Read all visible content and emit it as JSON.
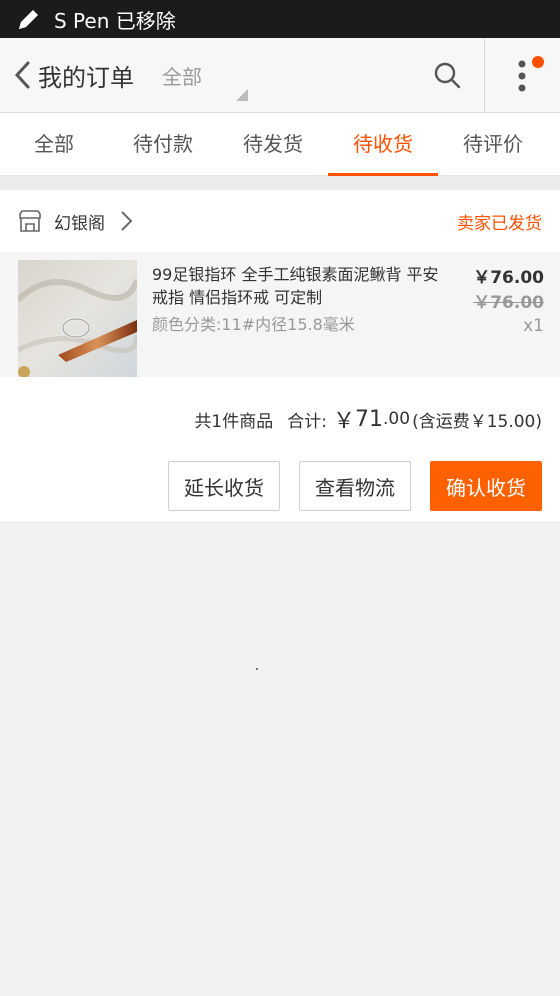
{
  "status_bar": {
    "text": "S Pen 已移除",
    "icon": "pen-icon"
  },
  "nav": {
    "back_icon": "chevron-left-icon",
    "title": "我的订单",
    "filter": "全部",
    "search_icon": "search-icon",
    "more_icon": "more-vertical-icon",
    "notification_dot_color": "#ff5000"
  },
  "tabs": [
    {
      "label": "全部",
      "active": false
    },
    {
      "label": "待付款",
      "active": false
    },
    {
      "label": "待发货",
      "active": false
    },
    {
      "label": "待收货",
      "active": true
    },
    {
      "label": "待评价",
      "active": false
    }
  ],
  "order": {
    "shop": {
      "icon": "shop-icon",
      "name": "幻银阁",
      "status": "卖家已发货"
    },
    "item": {
      "title": "99足银指环 全手工纯银素面泥鳅背 平安戒指 情侣指环戒 可定制",
      "spec": "颜色分类:11#内径15.8毫米",
      "price": "￥76.00",
      "original_price": "￥76.00",
      "quantity": "x1"
    },
    "summary": {
      "count_text": "共1件商品",
      "total_label": "合计:",
      "currency": "￥",
      "total_int": "71",
      "total_dec": ".00",
      "shipping": "(含运费￥15.00)"
    },
    "actions": {
      "extend": "延长收货",
      "logistics": "查看物流",
      "confirm": "确认收货"
    }
  },
  "colors": {
    "accent": "#ff5000",
    "confirm_button": "#ff6000"
  }
}
